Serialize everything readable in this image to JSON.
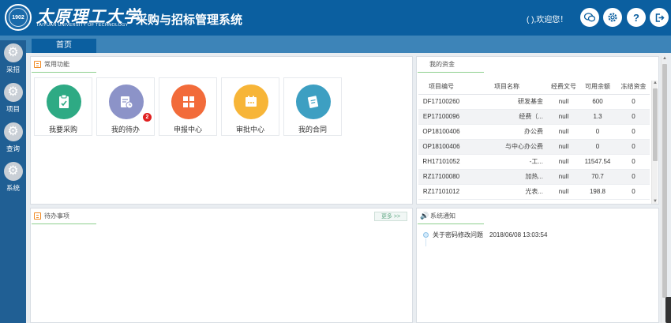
{
  "header": {
    "logo_seal_text": "1902",
    "logo_cn": "太原理工大学",
    "logo_en": "TAIYUAN UNIVERSITY OF TECHNOLOGY",
    "app_title": "采购与招标管理系统",
    "welcome": "(        ),欢迎您！",
    "buttons": [
      {
        "name": "wechat",
        "icon": "wechat-icon"
      },
      {
        "name": "settings",
        "icon": "gear-icon"
      },
      {
        "name": "help",
        "icon": "question-icon",
        "glyph": "?"
      },
      {
        "name": "logout",
        "icon": "logout-icon"
      }
    ]
  },
  "tabs": [
    {
      "label": "首页",
      "active": true
    }
  ],
  "sidebar": {
    "items": [
      {
        "label": "采招",
        "icon": "gear-icon"
      },
      {
        "label": "项目",
        "icon": "gear-icon"
      },
      {
        "label": "查询",
        "icon": "gear-icon"
      },
      {
        "label": "系统",
        "icon": "gear-icon"
      }
    ]
  },
  "quick": {
    "title": "常用功能",
    "tiles": [
      {
        "label": "我要采购",
        "icon": "clipboard-icon",
        "color": "#2eaa84"
      },
      {
        "label": "我的待办",
        "icon": "todo-list-icon",
        "color": "#8c93c8",
        "badge": "2"
      },
      {
        "label": "申报中心",
        "icon": "grid-icon",
        "color": "#f26b3a"
      },
      {
        "label": "审批中心",
        "icon": "approval-icon",
        "color": "#f7b538"
      },
      {
        "label": "我的合同",
        "icon": "contract-icon",
        "color": "#3d9fc2"
      }
    ]
  },
  "funds": {
    "title": "我的资金",
    "columns": [
      "项目编号",
      "项目名称",
      "经费文号",
      "可用余额",
      "冻结资金"
    ],
    "rows": [
      [
        "DF17100260",
        "研发基金",
        "null",
        "600",
        "0"
      ],
      [
        "EP17100096",
        "经费（...",
        "null",
        "1.3",
        "0"
      ],
      [
        "OP18100406",
        "办公费",
        "null",
        "0",
        "0"
      ],
      [
        "OP18100406",
        "与中心办公费",
        "null",
        "0",
        "0"
      ],
      [
        "RH17101052",
        "-工...",
        "null",
        "11547.54",
        "0"
      ],
      [
        "RZ17100080",
        "加热...",
        "null",
        "70.7",
        "0"
      ],
      [
        "RZ17101012",
        "光表...",
        "null",
        "198.8",
        "0"
      ]
    ]
  },
  "todo": {
    "title": "待办事项",
    "more": "更多 >>"
  },
  "notices": {
    "title": "系统通知",
    "items": [
      {
        "text": "关于密码修改问题",
        "time": "2018/06/08 13:03:54"
      }
    ]
  }
}
